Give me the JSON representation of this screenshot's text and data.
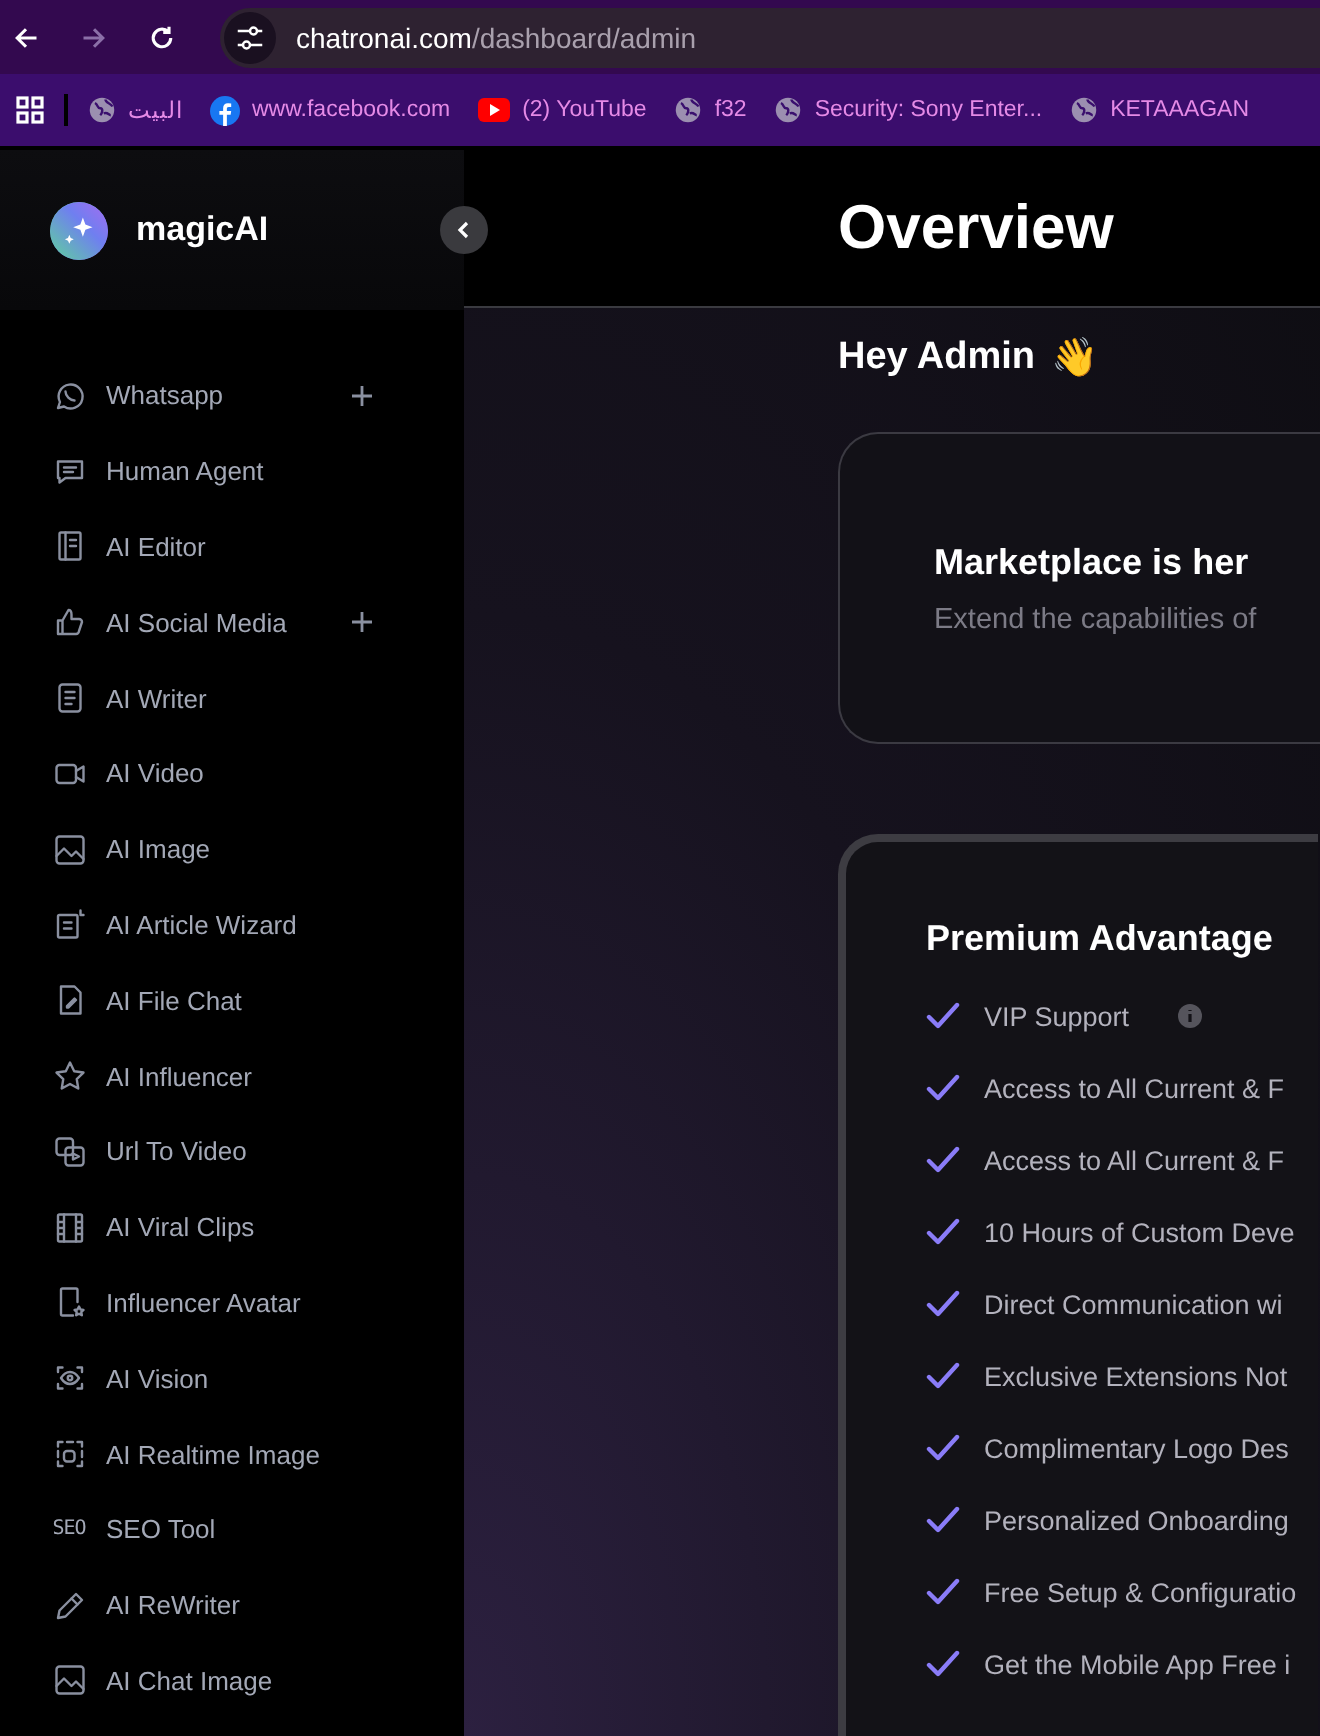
{
  "browser": {
    "url_host": "chatronai.com",
    "url_path": "/dashboard/admin",
    "bookmarks": [
      {
        "label": "البيت",
        "kind": "globe"
      },
      {
        "label": "www.facebook.com",
        "kind": "facebook"
      },
      {
        "label": "(2) YouTube",
        "kind": "youtube"
      },
      {
        "label": "f32",
        "kind": "globe"
      },
      {
        "label": "Security: Sony Enter...",
        "kind": "globe"
      },
      {
        "label": "KETAAAGAN",
        "kind": "globe"
      }
    ]
  },
  "sidebar": {
    "brand": "magicAI",
    "items": [
      {
        "label": "Whatsapp",
        "expandable": true
      },
      {
        "label": "Human Agent",
        "expandable": false
      },
      {
        "label": "AI Editor",
        "expandable": false
      },
      {
        "label": "AI Social Media",
        "expandable": true
      },
      {
        "label": "AI Writer",
        "expandable": false
      },
      {
        "label": "AI Video",
        "expandable": false
      },
      {
        "label": "AI Image",
        "expandable": false
      },
      {
        "label": "AI Article Wizard",
        "expandable": false
      },
      {
        "label": "AI File Chat",
        "expandable": false
      },
      {
        "label": "AI Influencer",
        "expandable": false
      },
      {
        "label": "Url To Video",
        "expandable": false
      },
      {
        "label": "AI Viral Clips",
        "expandable": false
      },
      {
        "label": "Influencer Avatar",
        "expandable": false
      },
      {
        "label": "AI Vision",
        "expandable": false
      },
      {
        "label": "AI Realtime Image",
        "expandable": false
      },
      {
        "label": "SEO Tool",
        "expandable": false,
        "icon_text": "SEO"
      },
      {
        "label": "AI ReWriter",
        "expandable": false
      },
      {
        "label": "AI Chat Image",
        "expandable": false
      }
    ]
  },
  "main": {
    "title": "Overview",
    "greeting": "Hey Admin",
    "greeting_emoji": "👋",
    "marketplace": {
      "title": "Marketplace is her",
      "text": "Extend the capabilities of"
    },
    "premium": {
      "title": "Premium Advantage",
      "features": [
        {
          "text": "VIP Support",
          "info": true
        },
        {
          "text": "Access to All Current & F",
          "info": false
        },
        {
          "text": "Access to All Current & F",
          "info": false
        },
        {
          "text": "10 Hours of Custom Deve",
          "info": false
        },
        {
          "text": "Direct Communication wi",
          "info": false
        },
        {
          "text": "Exclusive Extensions Not",
          "info": false
        },
        {
          "text": "Complimentary Logo Des",
          "info": false
        },
        {
          "text": "Personalized Onboarding",
          "info": false
        },
        {
          "text": "Free Setup & Configuratio",
          "info": false
        },
        {
          "text": "Get the Mobile App Free i",
          "info": false
        }
      ]
    }
  }
}
